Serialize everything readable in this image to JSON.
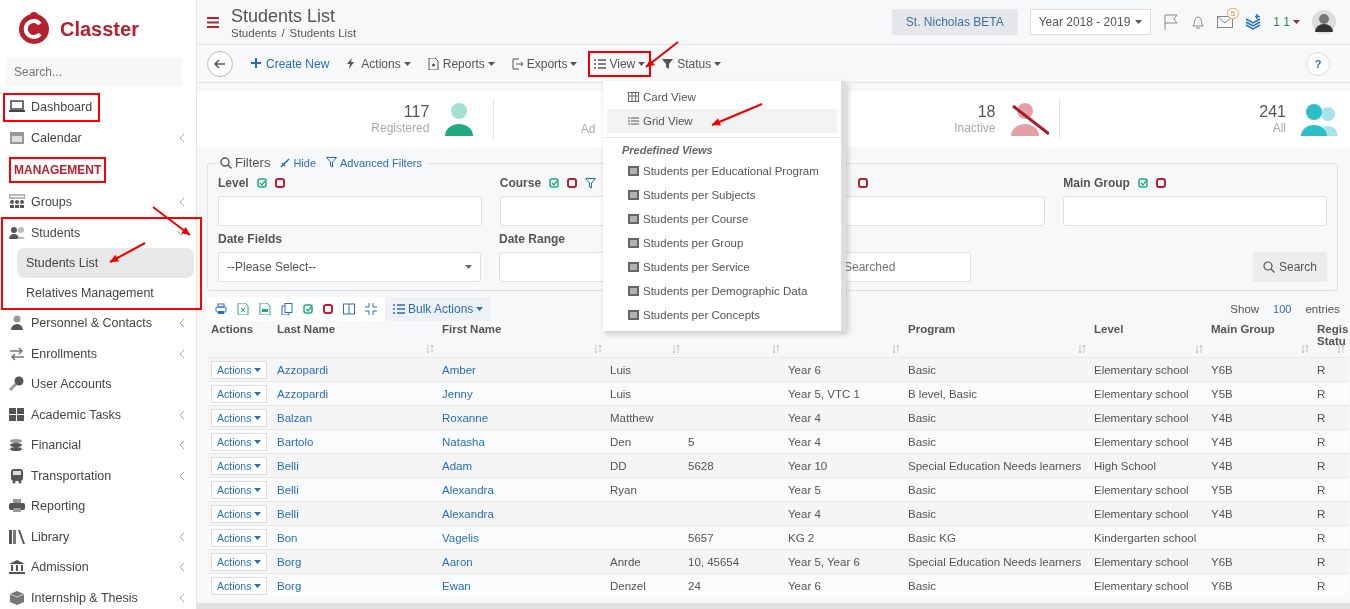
{
  "sidebar": {
    "brand": "Classter",
    "search": {
      "placeholder": "Search..."
    },
    "items": [
      {
        "kind": "item",
        "label": "Dashboard",
        "has_children": false
      },
      {
        "kind": "item",
        "label": "Calendar",
        "has_children": true
      },
      {
        "kind": "header",
        "label": "MANAGEMENT"
      },
      {
        "kind": "item",
        "label": "Groups",
        "has_children": true
      },
      {
        "kind": "item",
        "label": "Students",
        "has_children": true,
        "expanded": true,
        "children": [
          {
            "label": "Students List",
            "selected": true
          },
          {
            "label": "Relatives Management",
            "selected": false
          }
        ]
      },
      {
        "kind": "item",
        "label": "Personnel & Contacts",
        "has_children": true
      },
      {
        "kind": "item",
        "label": "Enrollments",
        "has_children": true
      },
      {
        "kind": "item",
        "label": "User Accounts",
        "has_children": false
      },
      {
        "kind": "item",
        "label": "Academic Tasks",
        "has_children": true
      },
      {
        "kind": "item",
        "label": "Financial",
        "has_children": true
      },
      {
        "kind": "item",
        "label": "Transportation",
        "has_children": true
      },
      {
        "kind": "item",
        "label": "Reporting",
        "has_children": false
      },
      {
        "kind": "item",
        "label": "Library",
        "has_children": true
      },
      {
        "kind": "item",
        "label": "Admission",
        "has_children": true
      },
      {
        "kind": "item",
        "label": "Internship & Thesis",
        "has_children": true
      }
    ]
  },
  "header": {
    "title": "Students List",
    "breadcrumb": [
      "Students",
      "Students List"
    ],
    "breadcrumb_separator": "/",
    "school": "St. Nicholas BETA",
    "year": "Year 2018 - 2019",
    "mail_count": "5",
    "user": "1 1"
  },
  "toolbar": {
    "buttons": [
      {
        "kind": "create",
        "label": "Create New",
        "highlighted": false
      },
      {
        "kind": "actions",
        "label": "Actions",
        "highlighted": false
      },
      {
        "kind": "reports",
        "label": "Reports",
        "highlighted": false
      },
      {
        "kind": "exports",
        "label": "Exports",
        "highlighted": false
      },
      {
        "kind": "view",
        "label": "View",
        "highlighted": true
      },
      {
        "kind": "status",
        "label": "Status",
        "highlighted": false
      }
    ],
    "help": "?"
  },
  "view_menu": {
    "items": [
      {
        "label": "Card View",
        "selected": false
      },
      {
        "label": "Grid View",
        "selected": true
      }
    ],
    "section": "Predefined Views",
    "predefined": [
      "Students per Educational Program",
      "Students per Subjects",
      "Students per Course",
      "Students per Group",
      "Students per Service",
      "Students per Demographic Data",
      "Students per Concepts"
    ]
  },
  "stats": [
    {
      "value": "117",
      "label": "Registered",
      "kind": "registered"
    },
    {
      "label": "Ad",
      "kind": "partial"
    },
    {
      "value": "18",
      "label": "Inactive",
      "kind": "inactive"
    },
    {
      "value": "241",
      "label": "All",
      "kind": "all"
    }
  ],
  "filters": {
    "title": "Filters",
    "hide": "Hide",
    "advanced": "Advanced Filters",
    "fields": [
      {
        "label": "Level",
        "kind": "multi"
      },
      {
        "label": "Course",
        "kind": "multi",
        "filter_icon": true
      },
      {
        "kind": "multi_hidden"
      },
      {
        "label": "Main Group",
        "kind": "multi"
      }
    ],
    "date_fields": {
      "label": "Date Fields",
      "value": "--Please Select--"
    },
    "date_range": {
      "label": "Date Range"
    },
    "searched": {
      "placeholder": "Searched"
    },
    "search_button": "Search"
  },
  "table": {
    "bulk_actions": "Bulk Actions",
    "show": "Show",
    "page_size": "100",
    "entries": "entries",
    "columns": [
      {
        "header": "Actions",
        "kind": "action",
        "sortable": false
      },
      {
        "header": "Last Name",
        "kind": "link",
        "sortable": true
      },
      {
        "header": "First Name",
        "kind": "link",
        "sortable": true
      },
      {
        "kind": "text",
        "sortable": true
      },
      {
        "kind": "text",
        "sortable": true
      },
      {
        "kind": "text",
        "sortable": true
      },
      {
        "header": "Program",
        "kind": "text",
        "sortable": true
      },
      {
        "header": "Level",
        "kind": "text",
        "sortable": true
      },
      {
        "header": "Main Group",
        "kind": "text",
        "sortable": true
      },
      {
        "header": "Regis Statu",
        "kind": "text",
        "sortable": true
      }
    ],
    "rows": [
      {
        "cells": [
          "Actions",
          "Azzopardi",
          "Amber",
          "Luis",
          null,
          "Year 6",
          "Basic",
          "Elementary school",
          "Y6B",
          "R"
        ]
      },
      {
        "cells": [
          "Actions",
          "Azzopardi",
          "Jenny",
          "Luis",
          null,
          "Year 5, VTC 1",
          "B level, Basic",
          "Elementary school",
          "Y5B",
          "R"
        ]
      },
      {
        "cells": [
          "Actions",
          "Balzan",
          "Roxanne",
          "Matthew",
          null,
          "Year 4",
          "Basic",
          "Elementary school",
          "Y4B",
          "R"
        ]
      },
      {
        "cells": [
          "Actions",
          "Bartolo",
          "Natasha",
          "Den",
          "5",
          "Year 4",
          "Basic",
          "Elementary school",
          "Y4B",
          "R"
        ]
      },
      {
        "cells": [
          "Actions",
          "Belli",
          "Adam",
          "DD",
          "5628",
          "Year 10",
          "Special Education Needs learners",
          "High School",
          "Y4B",
          "R"
        ]
      },
      {
        "cells": [
          "Actions",
          "Belli",
          "Alexandra",
          "Ryan",
          null,
          "Year 5",
          "Basic",
          "Elementary school",
          "Y5B",
          "R"
        ]
      },
      {
        "cells": [
          "Actions",
          "Belli",
          "Alexandra",
          null,
          null,
          "Year 4",
          "Basic",
          "Elementary school",
          "Y4B",
          "R"
        ]
      },
      {
        "cells": [
          "Actions",
          "Bon",
          "Vagelis",
          null,
          "5657",
          "KG 2",
          "Basic KG",
          "Kindergarten school",
          null,
          "R"
        ]
      },
      {
        "cells": [
          "Actions",
          "Borg",
          "Aaron",
          "Anrde",
          "10, 45654",
          "Year 5, Year 6",
          "Special Education Needs learners",
          "Elementary school",
          "Y6B",
          "R"
        ]
      },
      {
        "cells": [
          "Actions",
          "Borg",
          "Ewan",
          "Denzel",
          "24",
          "Year 6",
          "Basic",
          "Elementary school",
          "Y6B",
          "R"
        ]
      }
    ]
  }
}
